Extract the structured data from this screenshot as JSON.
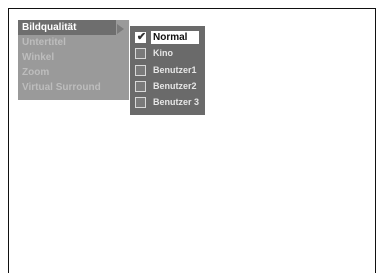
{
  "main_menu": {
    "items": [
      {
        "label": "Bildqualität",
        "selected": true
      },
      {
        "label": "Untertitel",
        "selected": false
      },
      {
        "label": "Winkel",
        "selected": false
      },
      {
        "label": "Zoom",
        "selected": false
      },
      {
        "label": "Virtual Surround",
        "selected": false
      }
    ]
  },
  "submenu": {
    "items": [
      {
        "label": "Normal",
        "checked": true
      },
      {
        "label": "Kino",
        "checked": false
      },
      {
        "label": "Benutzer1",
        "checked": false
      },
      {
        "label": "Benutzer2",
        "checked": false
      },
      {
        "label": "Benutzer 3",
        "checked": false
      }
    ]
  },
  "colors": {
    "menu_bg": "#9a9a9a",
    "submenu_bg": "#6a6a6a",
    "highlight": "#ffffff"
  },
  "icons": {
    "arrow": "chevron-right-icon",
    "check": "check-icon"
  }
}
